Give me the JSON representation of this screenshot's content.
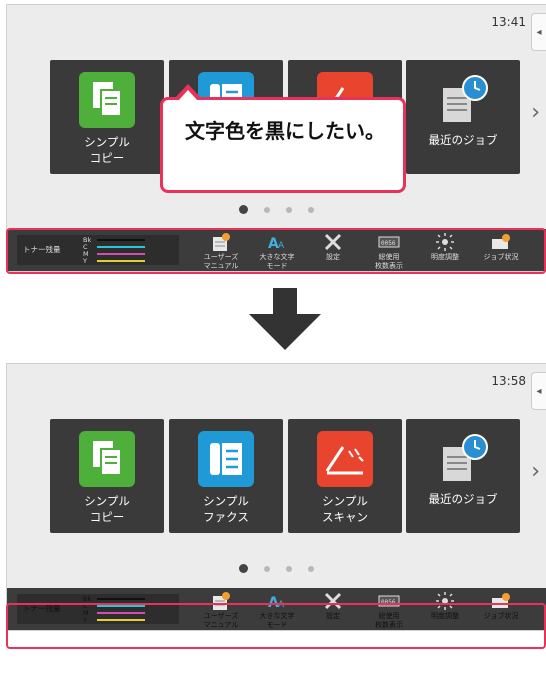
{
  "before": {
    "time": "13:41",
    "tiles": [
      {
        "line1": "シンプル",
        "line2": "コピー",
        "icon": "copy-icon"
      },
      {
        "line1": "",
        "line2": "",
        "icon": "fax-icon"
      },
      {
        "line1": "",
        "line2": "",
        "icon": "scan-icon"
      },
      {
        "line1": "最近のジョブ",
        "line2": "",
        "icon": "recent-jobs-icon"
      }
    ],
    "callout_text": "文字色を黒にしたい。"
  },
  "after": {
    "time": "13:58",
    "tiles": [
      {
        "line1": "シンプル",
        "line2": "コピー",
        "icon": "copy-icon"
      },
      {
        "line1": "シンプル",
        "line2": "ファクス",
        "icon": "fax-icon"
      },
      {
        "line1": "シンプル",
        "line2": "スキャン",
        "icon": "scan-icon"
      },
      {
        "line1": "最近のジョブ",
        "line2": "",
        "icon": "recent-jobs-icon"
      }
    ]
  },
  "taskbar": {
    "toner_label": "トナー残量",
    "toner_colors": [
      {
        "label": "Bk",
        "color": "#111111"
      },
      {
        "label": "C",
        "color": "#29c6d8"
      },
      {
        "label": "M",
        "color": "#d14fb2"
      },
      {
        "label": "Y",
        "color": "#e2d12a"
      }
    ],
    "items": [
      {
        "line1": "ユーザーズ",
        "line2": "マニュアル",
        "icon": "manual-icon"
      },
      {
        "line1": "大きな文字",
        "line2": "モード",
        "icon": "large-text-icon"
      },
      {
        "line1": "設定",
        "line2": "",
        "icon": "settings-icon"
      },
      {
        "line1": "総使用",
        "line2": "枚数表示",
        "icon": "counter-icon"
      },
      {
        "line1": "明度調整",
        "line2": "",
        "icon": "brightness-icon"
      },
      {
        "line1": "ジョブ状況",
        "line2": "",
        "icon": "job-status-icon"
      }
    ]
  },
  "colors": {
    "highlight": "#e8325a",
    "tile_bg": "#3a3a3a",
    "bar_bg": "#3c3c3c"
  }
}
